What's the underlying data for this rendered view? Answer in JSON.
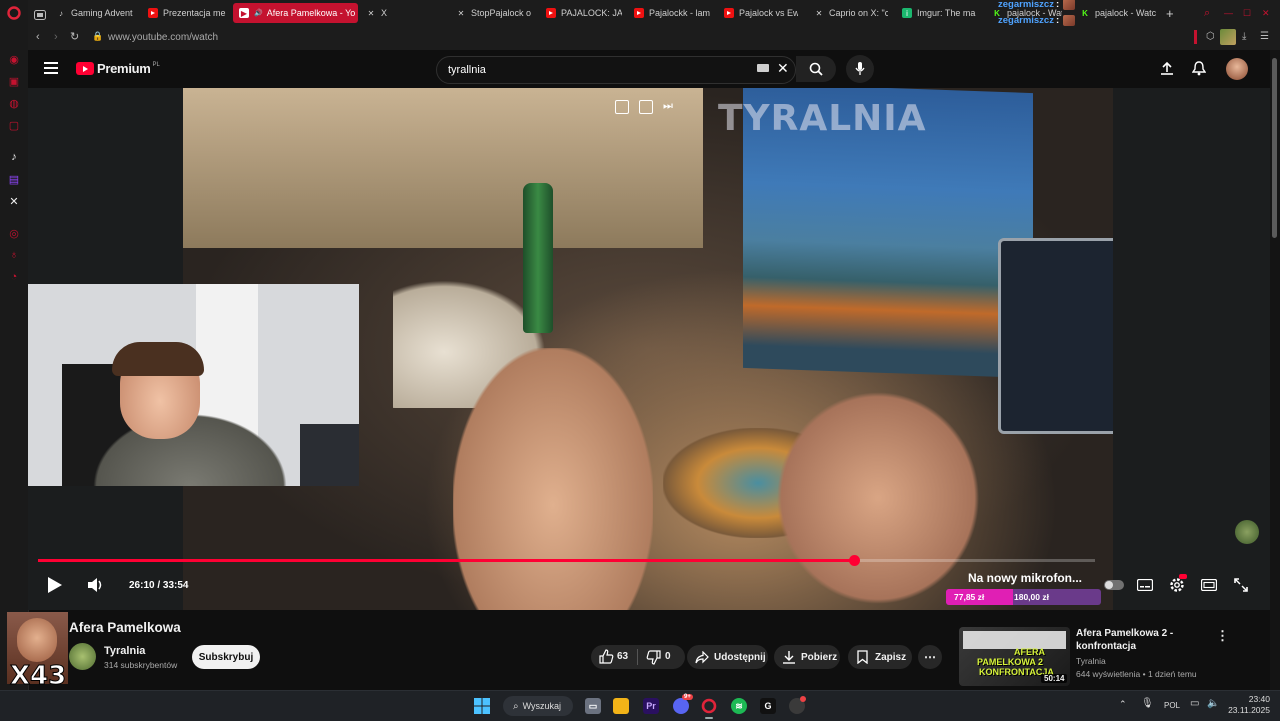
{
  "browser": {
    "tabs": [
      {
        "label": "Gaming Advent",
        "icon": "tiktok-icon"
      },
      {
        "label": "Prezentacja me",
        "icon": "youtube-icon"
      },
      {
        "label": "Afera Pamelkowa - Yo",
        "icon": "youtube-icon",
        "active": true
      },
      {
        "label": "X",
        "icon": "x-icon"
      },
      {
        "label": "StopPajalock o",
        "icon": "x-icon"
      },
      {
        "label": "PAJALOCK: JA",
        "icon": "youtube-icon"
      },
      {
        "label": "Pajalockk - lam",
        "icon": "youtube-icon"
      },
      {
        "label": "Pajalock vs Ew",
        "icon": "youtube-icon"
      },
      {
        "label": "Caprio on X: \"c",
        "icon": "x-icon"
      },
      {
        "label": "Imgur: The ma",
        "icon": "imgur-icon"
      },
      {
        "label": "pajalock - Wat",
        "icon": "kick-icon"
      },
      {
        "label": "pajalock - Watc",
        "icon": "kick-icon"
      }
    ],
    "url": "www.youtube.com/watch"
  },
  "chat_overlay": [
    {
      "user": "zegarmiszcz",
      "sep": ":"
    },
    {
      "user": "zegarmiszcz",
      "sep": ":"
    },
    {
      "user": "zegarmiszcz",
      "sep": ":"
    },
    {
      "user": "zegarmiszcz",
      "sep": ":"
    }
  ],
  "youtube": {
    "logo_text": "Premium",
    "logo_region": "PL",
    "search_value": "tyrallnia"
  },
  "video": {
    "watermark": "TYRALNIA",
    "time_current": "26:10",
    "time_separator": "/",
    "time_total": "33:54",
    "progress": 0.772,
    "overlay_title": "Na nowy mikrofon...",
    "donation_current": "77,85 zł",
    "donation_goal": "180,00 zł",
    "donation_progress": 0.43
  },
  "video_info": {
    "title": "Afera Pamelkowa",
    "channel_name": "Tyralnia",
    "subscribers": "314 subskrybentów",
    "subscribe_label": "Subskrybuj",
    "likes": "63",
    "dislikes": "0",
    "share_label": "Udostępnij",
    "download_label": "Pobierz",
    "save_label": "Zapisz"
  },
  "sidebar_video": {
    "title_line1": "Afera Pamelkowa 2 -",
    "title_line2": "konfrontacja",
    "channel": "Tyralnia",
    "meta": "644 wyświetlenia • 1 dzień temu",
    "duration": "50:14",
    "thumb_line1": "AFERA",
    "thumb_line2": "PAMELKOWA 2",
    "thumb_line3": "KONFRONTACJA"
  },
  "overlay_badge": "X43",
  "taskbar": {
    "search_label": "Wyszukaj",
    "lang": "POL",
    "time": "23:40",
    "date": "23.11.2025",
    "discord_badge": "9+"
  },
  "colors": {
    "accent_red": "#ff0033",
    "opera_red": "#c4122f",
    "chat_blue": "#4fa3ff",
    "donation_pink": "#e01fb4"
  }
}
